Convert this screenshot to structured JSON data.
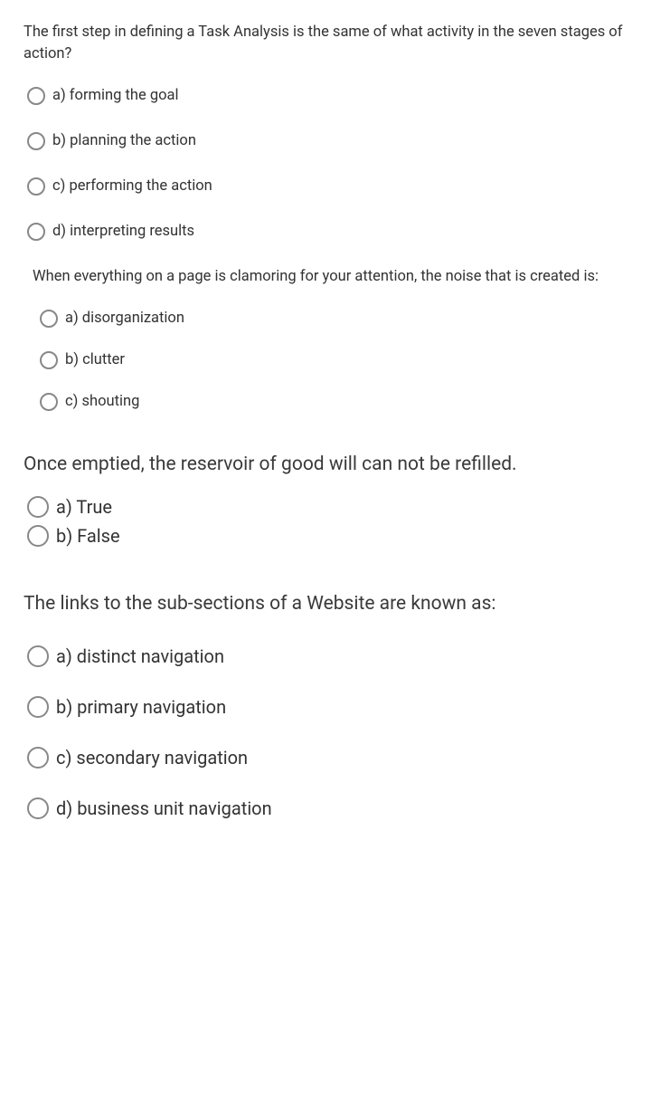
{
  "questions": [
    {
      "prompt": "The first step in defining a Task Analysis is the same of what activity in the seven stages of action?",
      "options": [
        "a) forming the goal",
        "b) planning the action",
        "c) performing the action",
        "d) interpreting results"
      ]
    },
    {
      "prompt": "When everything on a page is clamoring for your attention, the noise that is created is:",
      "options": [
        "a) disorganization",
        "b) clutter",
        "c) shouting"
      ]
    },
    {
      "prompt": "Once emptied, the reservoir of good will can not be refilled.",
      "options": [
        "a) True",
        "b) False"
      ]
    },
    {
      "prompt": "The links to the sub-sections of a Website are known as:",
      "options": [
        "a) distinct navigation",
        "b) primary navigation",
        "c) secondary navigation",
        "d) business unit navigation"
      ]
    }
  ]
}
